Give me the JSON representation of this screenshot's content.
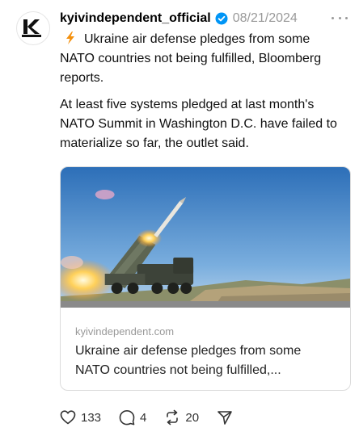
{
  "post": {
    "username": "kyivindependent_official",
    "date": "08/21/2024",
    "avatar_letter": "K",
    "paragraph1": "Ukraine air defense pledges from some NATO countries not being fulfilled, Bloomberg reports.",
    "paragraph2": "At least five systems pledged at last month's NATO Summit in Washington D.C. have failed to materialize so far, the outlet said."
  },
  "card": {
    "domain": "kyivindependent.com",
    "title": "Ukraine air defense pledges from some NATO countries not being fulfilled,..."
  },
  "actions": {
    "likes": "133",
    "comments": "4",
    "reposts": "20"
  },
  "icons": {
    "verified": "verified-badge-icon",
    "bolt": "lightning-bolt-icon",
    "more": "more-dots-icon",
    "like": "heart-icon",
    "comment": "comment-bubble-icon",
    "repost": "repost-icon",
    "share": "send-icon"
  },
  "colors": {
    "verified_blue": "#0095f6",
    "bolt_orange": "#f4900c",
    "muted_gray": "#999999"
  }
}
